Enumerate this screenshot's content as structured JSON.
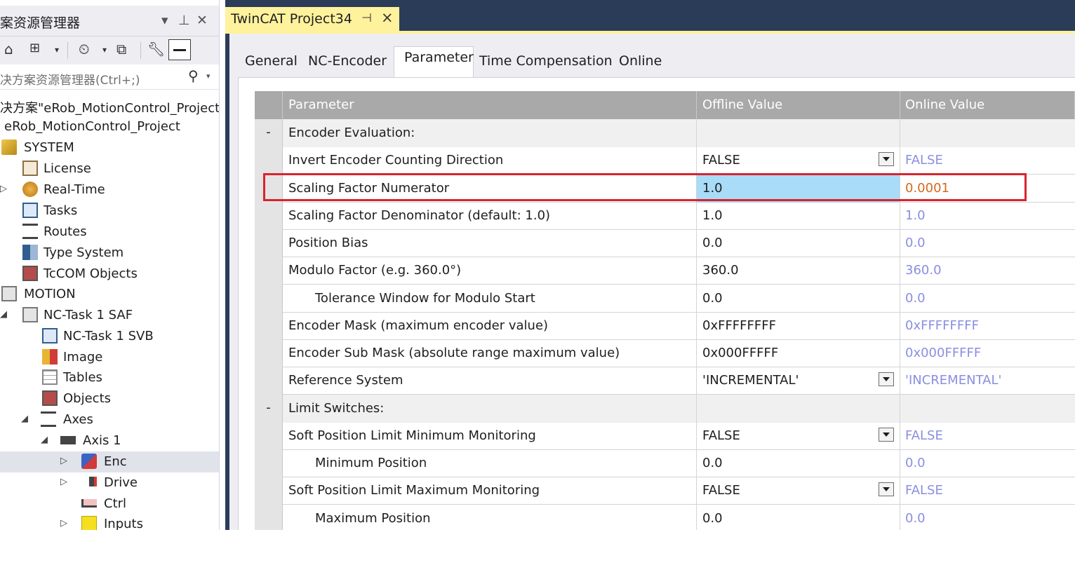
{
  "explorer": {
    "title": "案资源管理器",
    "search_placeholder": "决方案资源管理器(Ctrl+;)",
    "tree": [
      {
        "label": "决方案\"eRob_MotionControl_Project",
        "icon": "none",
        "expander": ""
      },
      {
        "label": "eRob_MotionControl_Project",
        "icon": "none",
        "expander": ""
      },
      {
        "label": "SYSTEM",
        "icon": "system-icon",
        "expander": ""
      },
      {
        "label": "License",
        "icon": "license-icon",
        "expander": ""
      },
      {
        "label": "Real-Time",
        "icon": "realtime-icon",
        "expander": "▷"
      },
      {
        "label": "Tasks",
        "icon": "tasks-icon",
        "expander": ""
      },
      {
        "label": "Routes",
        "icon": "routes-icon",
        "expander": ""
      },
      {
        "label": "Type System",
        "icon": "type-system-icon",
        "expander": ""
      },
      {
        "label": "TcCOM Objects",
        "icon": "tccom-icon",
        "expander": ""
      },
      {
        "label": "MOTION",
        "icon": "motion-icon",
        "expander": ""
      },
      {
        "label": "NC-Task 1 SAF",
        "icon": "nc-task-icon",
        "expander": "◢"
      },
      {
        "label": "NC-Task 1 SVB",
        "icon": "nc-svb-icon",
        "expander": ""
      },
      {
        "label": "Image",
        "icon": "image-icon",
        "expander": ""
      },
      {
        "label": "Tables",
        "icon": "tables-icon",
        "expander": ""
      },
      {
        "label": "Objects",
        "icon": "objects-icon",
        "expander": ""
      },
      {
        "label": "Axes",
        "icon": "axes-icon",
        "expander": "◢"
      },
      {
        "label": "Axis 1",
        "icon": "axis-icon",
        "expander": "◢"
      },
      {
        "label": "Enc",
        "icon": "encoder-icon",
        "expander": "▷"
      },
      {
        "label": "Drive",
        "icon": "drive-icon",
        "expander": "▷"
      },
      {
        "label": "Ctrl",
        "icon": "ctrl-icon",
        "expander": ""
      },
      {
        "label": "Inputs",
        "icon": "inputs-icon",
        "expander": "▷"
      }
    ]
  },
  "document": {
    "tab_title": "TwinCAT Project34",
    "tabs": [
      "General",
      "NC-Encoder",
      "Parameter",
      "Time Compensation",
      "Online"
    ],
    "active_tab": "Parameter"
  },
  "grid": {
    "headers": [
      "Parameter",
      "Offline Value",
      "Online Value"
    ],
    "rows": [
      {
        "type": "group",
        "toggle": "-",
        "name": "Encoder Evaluation:",
        "offline": "",
        "online": ""
      },
      {
        "type": "param",
        "name": "Invert Encoder Counting Direction",
        "offline": "FALSE",
        "online": "FALSE",
        "dropdown": true
      },
      {
        "type": "param",
        "name": "Scaling Factor Numerator",
        "offline": "1.0",
        "online": "0.0001",
        "editing": true,
        "changed": true
      },
      {
        "type": "param",
        "name": "Scaling Factor Denominator (default: 1.0)",
        "offline": "1.0",
        "online": "1.0"
      },
      {
        "type": "param",
        "name": "Position Bias",
        "offline": "0.0",
        "online": "0.0"
      },
      {
        "type": "param",
        "name": "Modulo Factor (e.g. 360.0°)",
        "offline": "360.0",
        "online": "360.0"
      },
      {
        "type": "param",
        "name": "Tolerance Window for Modulo Start",
        "offline": "0.0",
        "online": "0.0",
        "indent": true
      },
      {
        "type": "param",
        "name": "Encoder Mask (maximum encoder value)",
        "offline": "0xFFFFFFFF",
        "online": "0xFFFFFFFF"
      },
      {
        "type": "param",
        "name": "Encoder Sub Mask (absolute range maximum value)",
        "offline": "0x000FFFFF",
        "online": "0x000FFFFF"
      },
      {
        "type": "param",
        "name": "Reference System",
        "offline": "'INCREMENTAL'",
        "online": "'INCREMENTAL'",
        "dropdown": true
      },
      {
        "type": "group",
        "toggle": "-",
        "name": "Limit Switches:",
        "offline": "",
        "online": ""
      },
      {
        "type": "param",
        "name": "Soft Position Limit Minimum Monitoring",
        "offline": "FALSE",
        "online": "FALSE",
        "dropdown": true
      },
      {
        "type": "param",
        "name": "Minimum Position",
        "offline": "0.0",
        "online": "0.0",
        "indent": true
      },
      {
        "type": "param",
        "name": "Soft Position Limit Maximum Monitoring",
        "offline": "FALSE",
        "online": "FALSE",
        "dropdown": true
      },
      {
        "type": "param",
        "name": "Maximum Position",
        "offline": "0.0",
        "online": "0.0",
        "indent": true
      }
    ]
  },
  "colors": {
    "tab_accent": "#fff29d",
    "frame": "#2b3c59",
    "editing_cell": "#a8dcf7",
    "online_value": "#8a8ee0",
    "changed_value": "#d2691e",
    "highlight_box": "#d9232e"
  }
}
